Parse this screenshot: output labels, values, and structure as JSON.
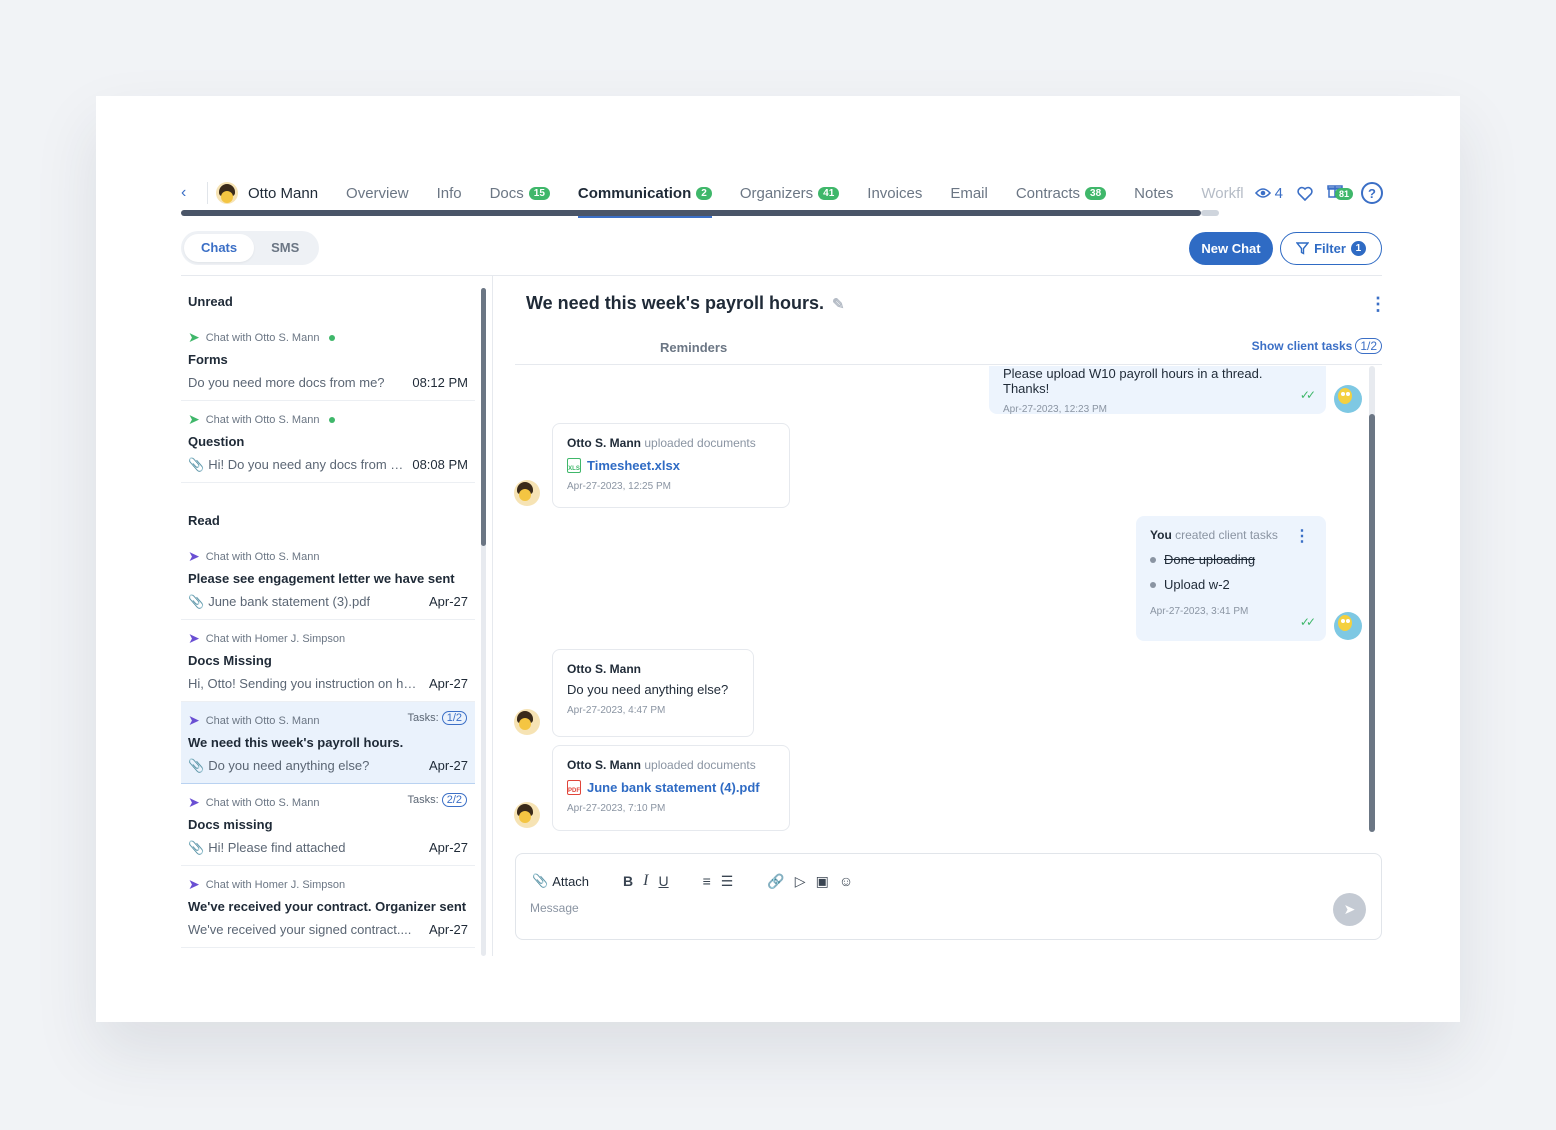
{
  "nav": {
    "client_name": "Otto Mann",
    "tabs": [
      {
        "label": "Overview"
      },
      {
        "label": "Info"
      },
      {
        "label": "Docs",
        "count": "15"
      },
      {
        "label": "Communication",
        "count": "2"
      },
      {
        "label": "Organizers",
        "count": "41"
      },
      {
        "label": "Invoices"
      },
      {
        "label": "Email"
      },
      {
        "label": "Contracts",
        "count": "38"
      },
      {
        "label": "Notes"
      },
      {
        "label": "Workfl"
      }
    ],
    "viewers_count": "4",
    "gift_badge": "81",
    "help_label": "?"
  },
  "toolbar": {
    "segment_chats": "Chats",
    "segment_sms": "SMS",
    "new_chat": "New Chat",
    "filter": "Filter",
    "filter_count": "1"
  },
  "list": {
    "unread_header": "Unread",
    "read_header": "Read",
    "unread": [
      {
        "from": "Chat with Otto S. Mann",
        "subject": "Forms",
        "preview": "Do you need more docs from me?",
        "date": "08:12 PM"
      },
      {
        "from": "Chat with Otto S. Mann",
        "subject": "Question",
        "preview": "Hi! Do you need any docs from me t...",
        "date": "08:08 PM"
      }
    ],
    "read": [
      {
        "from": "Chat with Otto S. Mann",
        "subject": "Please see engagement letter we have sent",
        "preview": "June bank statement (3).pdf",
        "date": "Apr-27"
      },
      {
        "from": "Chat with Homer J. Simpson",
        "subject": "Docs Missing",
        "preview": "Hi, Otto! Sending you instruction on how t...",
        "date": "Apr-27"
      },
      {
        "from": "Chat with Otto S. Mann",
        "subject": "We need this week's payroll hours.",
        "preview": "Do you need anything else?",
        "date": "Apr-27",
        "tasks": "1/2"
      },
      {
        "from": "Chat with Otto S. Mann",
        "subject": "Docs missing",
        "preview": "Hi! Please find attached",
        "date": "Apr-27",
        "tasks": "2/2"
      },
      {
        "from": "Chat with Homer J. Simpson",
        "subject": "We've received your contract. Organizer sent",
        "preview": "We've received your signed contract....",
        "date": "Apr-27"
      }
    ],
    "tasks_label": "Tasks:"
  },
  "chat": {
    "title": "We need this week's payroll hours.",
    "subtab_reminders": "Reminders",
    "show_tasks": "Show client tasks",
    "show_tasks_count": "1/2",
    "messages": {
      "m1_text": "Please upload W10 payroll hours in a thread. Thanks!",
      "m1_ts": "Apr-27-2023, 12:23 PM",
      "m2_who": "Otto S. Mann",
      "m2_action": "uploaded documents",
      "m2_file": "Timesheet.xlsx",
      "m2_ts": "Apr-27-2023, 12:25 PM",
      "m3_who": "You",
      "m3_action": "created client tasks",
      "m3_task1": "Done uploading",
      "m3_task2": "Upload w-2",
      "m3_ts": "Apr-27-2023, 3:41 PM",
      "m4_who": "Otto S. Mann",
      "m4_text": "Do you need anything else?",
      "m4_ts": "Apr-27-2023, 4:47 PM",
      "m5_who": "Otto S. Mann",
      "m5_action": "uploaded documents",
      "m5_file": "June bank statement (4).pdf",
      "m5_ts": "Apr-27-2023, 7:10 PM"
    }
  },
  "composer": {
    "attach": "Attach",
    "placeholder": "Message"
  },
  "colors": {
    "accent": "#2f6bc4",
    "success": "#3fb76a"
  }
}
